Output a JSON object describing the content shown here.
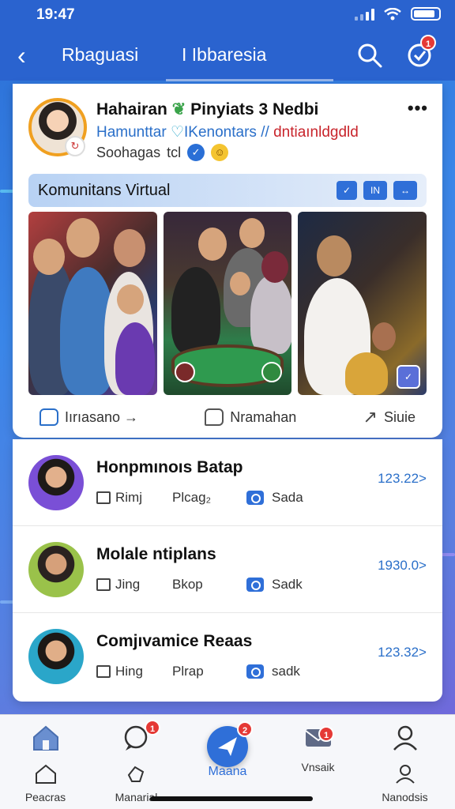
{
  "status_bar": {
    "time": "19:47"
  },
  "header": {
    "back_icon": "chevron-left-icon",
    "tabs": [
      {
        "label": "Rbaguasi"
      },
      {
        "label": "I Ibbaresia"
      }
    ],
    "search_icon": "search-icon",
    "notification_icon": "check-circle-icon",
    "notification_badge": "1"
  },
  "post": {
    "author_line": "Hahairan",
    "author_suffix": "Pinyiats 3 Nedbi",
    "subtitle_a": "Hamunttar",
    "subtitle_b": "IKenontars",
    "subtitle_sep": "//",
    "subtitle_c": "dntiaınldgdld",
    "meta_text": "Soohagas",
    "meta_extra": "tcl",
    "more_label": "•••",
    "community_label": "Komunitans Virtual",
    "community_icons": [
      "check-icon",
      "grid-icon",
      "arrows-icon"
    ],
    "actions": [
      {
        "label": "Iırıasano →"
      },
      {
        "label": "Nramahan"
      },
      {
        "label": "Siuie"
      }
    ]
  },
  "list": [
    {
      "name": "Honpmınoıs Batap",
      "mail": "Rimj",
      "mid": "Plcag₂",
      "cam": "Sada",
      "count": "123.22>"
    },
    {
      "name": "Molale ntiplans",
      "mail": "Jing",
      "mid": "Bkop",
      "cam": "Sadk",
      "count": "1930.0>"
    },
    {
      "name": "Comjıvamice Reaas",
      "mail": "Hing",
      "mid": "Plrap",
      "cam": "sadk",
      "count": "123.32>"
    }
  ],
  "bottom_nav": {
    "items": [
      {
        "label": "Peacras",
        "icon": "home-icon"
      },
      {
        "label": "Manarial",
        "icon": "chat-icon",
        "badge": "1"
      },
      {
        "label": "Maana",
        "icon": "send-icon",
        "badge": "2"
      },
      {
        "label": "Vnsaik",
        "icon": "mail-icon",
        "badge": "1"
      },
      {
        "label": "Nanodsis",
        "icon": "user-icon"
      }
    ]
  },
  "colors": {
    "brand": "#2a63cf",
    "accent": "#2f6fd8",
    "badge": "#e53935"
  }
}
